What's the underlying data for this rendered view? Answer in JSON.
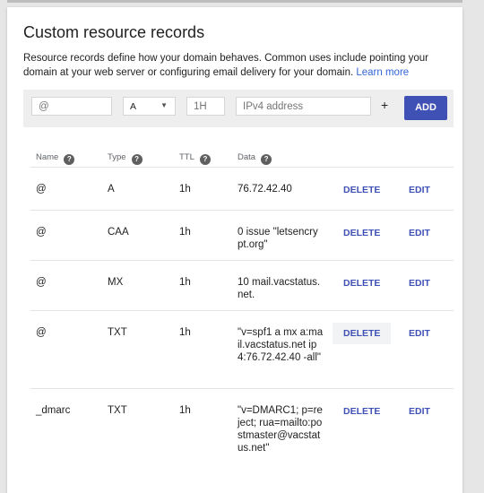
{
  "title": "Custom resource records",
  "description": "Resource records define how your domain behaves. Common uses include pointing your domain at your web server or configuring email delivery for your domain.",
  "learn_more": "Learn more",
  "add_form": {
    "name_placeholder": "@",
    "type_value": "A",
    "ttl_placeholder": "1H",
    "data_placeholder": "IPv4 address",
    "plus": "+",
    "add_label": "ADD"
  },
  "headers": {
    "name": "Name",
    "type": "Type",
    "ttl": "TTL",
    "data": "Data",
    "help": "?"
  },
  "actions": {
    "delete": "DELETE",
    "edit": "EDIT"
  },
  "records": [
    {
      "name": "@",
      "type": "A",
      "ttl": "1h",
      "data": "76.72.42.40"
    },
    {
      "name": "@",
      "type": "CAA",
      "ttl": "1h",
      "data": "0 issue \"letsencrypt.org\""
    },
    {
      "name": "@",
      "type": "MX",
      "ttl": "1h",
      "data": "10 mail.vacstatus.net."
    },
    {
      "name": "@",
      "type": "TXT",
      "ttl": "1h",
      "data": "\"v=spf1 a mx a:mail.vacstatus.net ip4:76.72.42.40 -all\""
    },
    {
      "name": "_dmarc",
      "type": "TXT",
      "ttl": "1h",
      "data": "\"v=DMARC1; p=reject; rua=mailto:postmaster@vacstatus.net\""
    }
  ]
}
